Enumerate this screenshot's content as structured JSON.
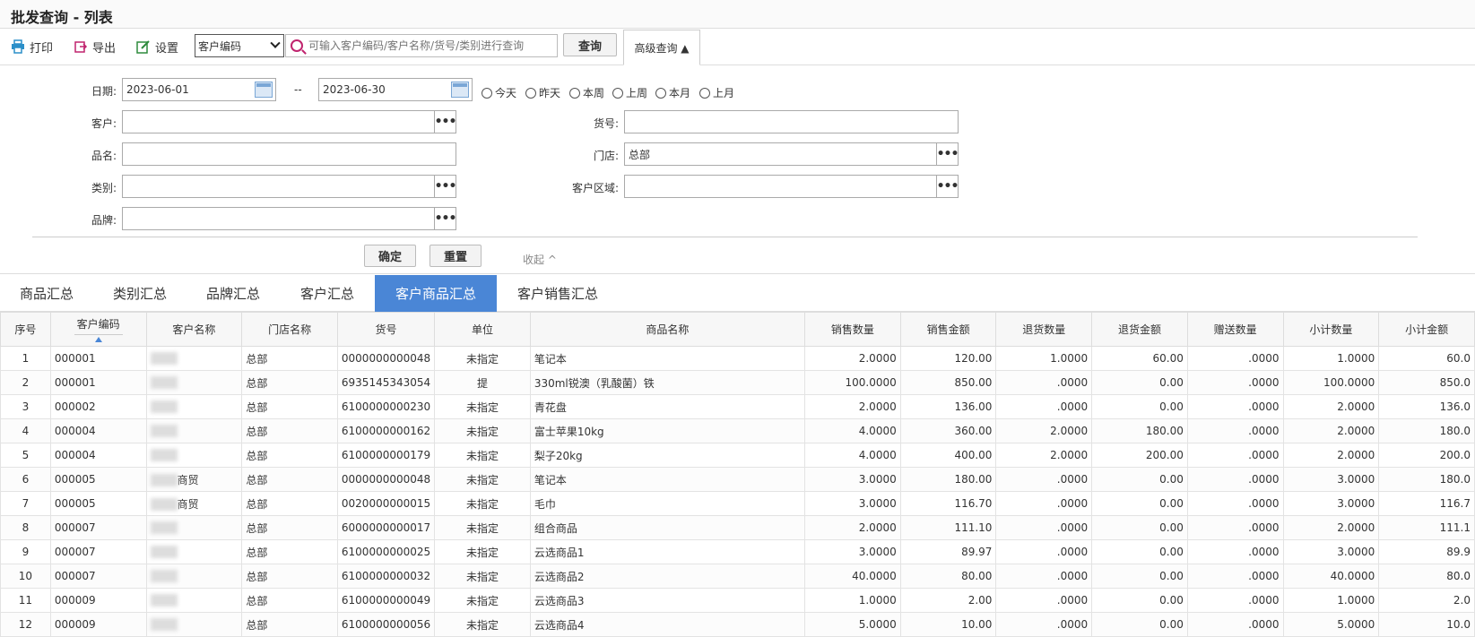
{
  "window": {
    "title": "批发查询 - 列表"
  },
  "toolbar": {
    "print_label": "打印",
    "export_label": "导出",
    "settings_label": "设置",
    "search_field_selected": "客户编码",
    "search_placeholder": "可输入客户编码/客户名称/货号/类别进行查询",
    "query_label": "查询",
    "advanced_label": "高级查询 ▲"
  },
  "filter": {
    "date_label": "日期:",
    "date_from": "2023-06-01",
    "date_sep": "--",
    "date_to": "2023-06-30",
    "quick_dates": [
      "今天",
      "昨天",
      "本周",
      "上周",
      "本月",
      "上月"
    ],
    "customer_label": "客户:",
    "customer_value": "",
    "sku_label": "货号:",
    "sku_value": "",
    "name_label": "品名:",
    "name_value": "",
    "store_label": "门店:",
    "store_value": "总部",
    "category_label": "类别:",
    "category_value": "",
    "region_label": "客户区域:",
    "region_value": "",
    "brand_label": "品牌:",
    "brand_value": "",
    "confirm_label": "确定",
    "reset_label": "重置",
    "collapse_label": "收起 ^"
  },
  "tabs": [
    "商品汇总",
    "类别汇总",
    "品牌汇总",
    "客户汇总",
    "客户商品汇总",
    "客户销售汇总"
  ],
  "active_tab": 4,
  "table": {
    "headers": [
      "序号",
      "客户编码",
      "客户名称",
      "门店名称",
      "货号",
      "单位",
      "商品名称",
      "销售数量",
      "销售金额",
      "退货数量",
      "退货金额",
      "赠送数量",
      "小计数量",
      "小计金额"
    ],
    "rows": [
      [
        "1",
        "000001",
        "",
        "总部",
        "0000000000048",
        "未指定",
        "笔记本",
        "2.0000",
        "120.00",
        "1.0000",
        "60.00",
        ".0000",
        "1.0000",
        "60.0"
      ],
      [
        "2",
        "000001",
        "",
        "总部",
        "6935145343054",
        "提",
        "330ml锐澳（乳酸菌）铁",
        "100.0000",
        "850.00",
        ".0000",
        "0.00",
        ".0000",
        "100.0000",
        "850.0"
      ],
      [
        "3",
        "000002",
        "",
        "总部",
        "6100000000230",
        "未指定",
        "青花盘",
        "2.0000",
        "136.00",
        ".0000",
        "0.00",
        ".0000",
        "2.0000",
        "136.0"
      ],
      [
        "4",
        "000004",
        "",
        "总部",
        "6100000000162",
        "未指定",
        "富士苹果10kg",
        "4.0000",
        "360.00",
        "2.0000",
        "180.00",
        ".0000",
        "2.0000",
        "180.0"
      ],
      [
        "5",
        "000004",
        "",
        "总部",
        "6100000000179",
        "未指定",
        "梨子20kg",
        "4.0000",
        "400.00",
        "2.0000",
        "200.00",
        ".0000",
        "2.0000",
        "200.0"
      ],
      [
        "6",
        "000005",
        "商贸",
        "总部",
        "0000000000048",
        "未指定",
        "笔记本",
        "3.0000",
        "180.00",
        ".0000",
        "0.00",
        ".0000",
        "3.0000",
        "180.0"
      ],
      [
        "7",
        "000005",
        "商贸",
        "总部",
        "0020000000015",
        "未指定",
        "毛巾",
        "3.0000",
        "116.70",
        ".0000",
        "0.00",
        ".0000",
        "3.0000",
        "116.7"
      ],
      [
        "8",
        "000007",
        "",
        "总部",
        "6000000000017",
        "未指定",
        "组合商品",
        "2.0000",
        "111.10",
        ".0000",
        "0.00",
        ".0000",
        "2.0000",
        "111.1"
      ],
      [
        "9",
        "000007",
        "",
        "总部",
        "6100000000025",
        "未指定",
        "云选商品1",
        "3.0000",
        "89.97",
        ".0000",
        "0.00",
        ".0000",
        "3.0000",
        "89.9"
      ],
      [
        "10",
        "000007",
        "",
        "总部",
        "6100000000032",
        "未指定",
        "云选商品2",
        "40.0000",
        "80.00",
        ".0000",
        "0.00",
        ".0000",
        "40.0000",
        "80.0"
      ],
      [
        "11",
        "000009",
        "",
        "总部",
        "6100000000049",
        "未指定",
        "云选商品3",
        "1.0000",
        "2.00",
        ".0000",
        "0.00",
        ".0000",
        "1.0000",
        "2.0"
      ],
      [
        "12",
        "000009",
        "",
        "总部",
        "6100000000056",
        "未指定",
        "云选商品4",
        "5.0000",
        "10.00",
        ".0000",
        "0.00",
        ".0000",
        "5.0000",
        "10.0"
      ]
    ]
  },
  "colors": {
    "accent": "#4a86d6",
    "print_icon": "#2b8fc9",
    "export_icon": "#c0246e",
    "settings_icon": "#2e8b3d"
  }
}
